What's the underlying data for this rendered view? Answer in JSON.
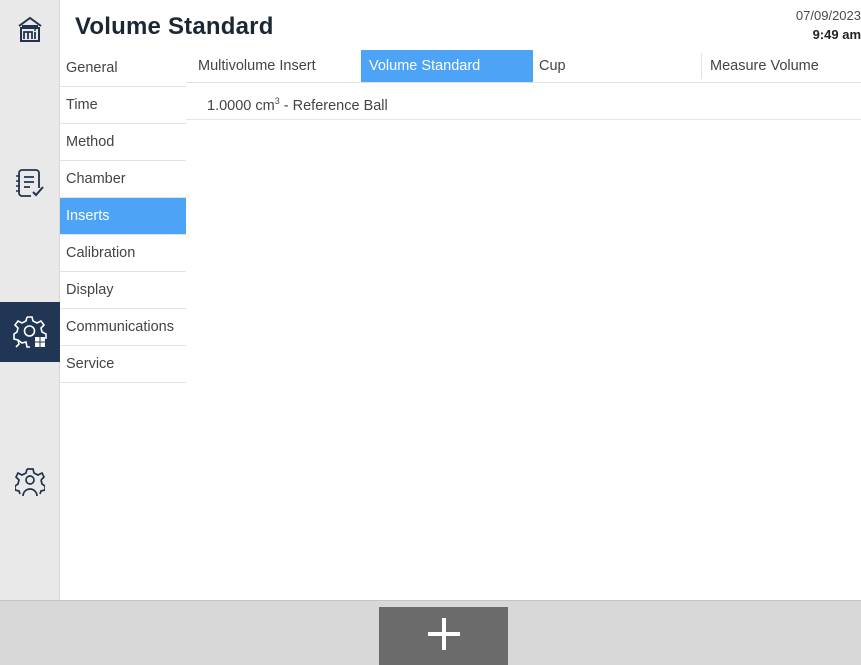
{
  "header": {
    "title": "Volume Standard",
    "date": "07/09/2023",
    "time": "9:49 am"
  },
  "rail": {
    "items": [
      {
        "icon": "home-mi-icon"
      },
      {
        "icon": "report-checklist-icon"
      },
      {
        "icon": "settings-gear-grid-icon",
        "active": true
      },
      {
        "icon": "user-gear-icon"
      }
    ]
  },
  "settings_menu": {
    "items": [
      {
        "label": "General"
      },
      {
        "label": "Time"
      },
      {
        "label": "Method"
      },
      {
        "label": "Chamber"
      },
      {
        "label": "Inserts",
        "active": true
      },
      {
        "label": "Calibration"
      },
      {
        "label": "Display"
      },
      {
        "label": "Communications"
      },
      {
        "label": "Service"
      }
    ]
  },
  "tabs": {
    "items": [
      {
        "label": "Multivolume Insert"
      },
      {
        "label": "Volume Standard",
        "active": true
      },
      {
        "label": "Cup"
      },
      {
        "label": "Measure Volume"
      }
    ]
  },
  "standards": {
    "rows": [
      {
        "value": "1.0000",
        "unit": "cm",
        "unit_power": "3",
        "description": " - Reference Ball"
      }
    ]
  },
  "footer": {
    "add_button_icon": "plus-icon"
  },
  "colors": {
    "accent": "#4da3f5",
    "rail_active": "#203654",
    "rail_bg": "#e9e9e9",
    "footer_bg": "#d8d8d8",
    "add_button": "#6b6b6b"
  }
}
